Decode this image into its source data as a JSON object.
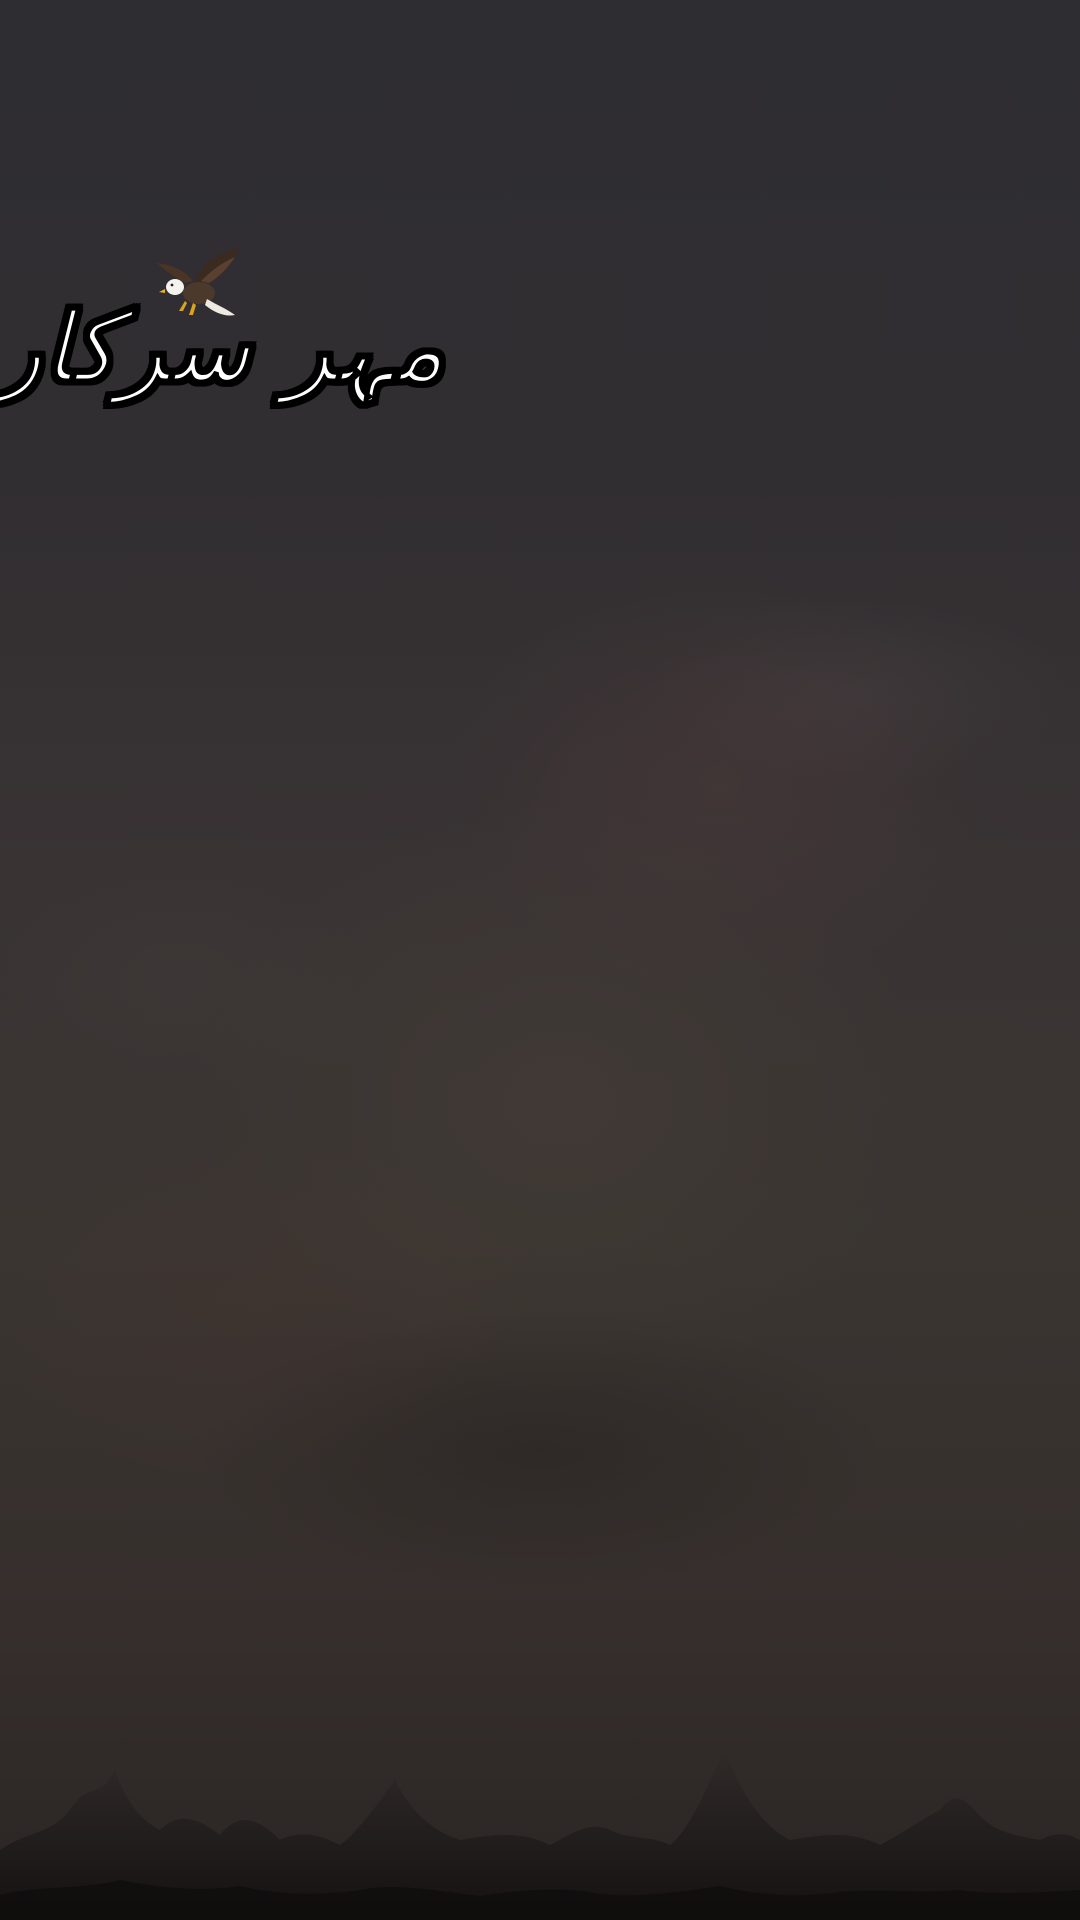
{
  "overlay": {
    "title": "مہر سرکار",
    "emblem_icon": "eagle-icon"
  },
  "colors": {
    "background_top": "#2e2d32",
    "background_mid": "#3a3531",
    "background_bottom": "#2a2524",
    "title_fill": "#ffffff",
    "title_outline": "#000000"
  }
}
